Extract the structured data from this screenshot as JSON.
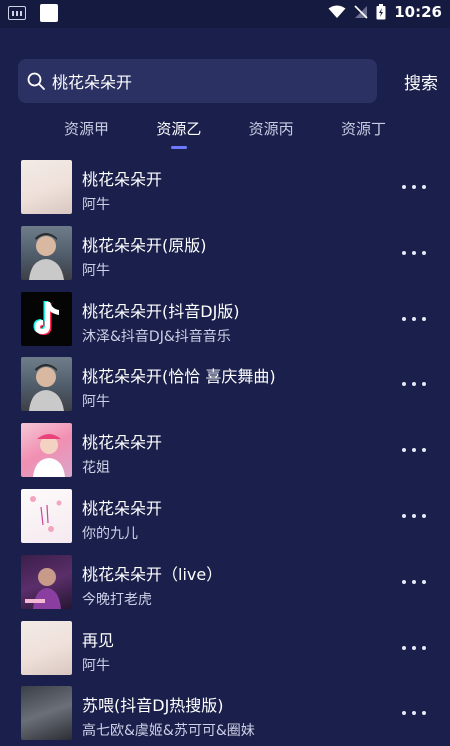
{
  "status_bar": {
    "time": "10:26"
  },
  "search": {
    "query": "桃花朵朵开",
    "button_label": "搜索"
  },
  "tabs": [
    {
      "label": "资源甲",
      "active": false
    },
    {
      "label": "资源乙",
      "active": true
    },
    {
      "label": "资源丙",
      "active": false
    },
    {
      "label": "资源丁",
      "active": false
    }
  ],
  "songs": [
    {
      "title": "桃花朵朵开",
      "artist": "阿牛",
      "cover": "photo-cover"
    },
    {
      "title": "桃花朵朵开(原版)",
      "artist": "阿牛",
      "cover": "man-cover"
    },
    {
      "title": "桃花朵朵开(抖音DJ版)",
      "artist": "沐泽&抖音DJ&抖音音乐",
      "cover": "tiktok-cover"
    },
    {
      "title": "桃花朵朵开(恰恰 喜庆舞曲)",
      "artist": "阿牛",
      "cover": "man-cover"
    },
    {
      "title": "桃花朵朵开",
      "artist": "花姐",
      "cover": "pink-cover"
    },
    {
      "title": "桃花朵朵开",
      "artist": "你的九儿",
      "cover": "white-cover"
    },
    {
      "title": "桃花朵朵开（live）",
      "artist": "今晚打老虎",
      "cover": "purple-cover"
    },
    {
      "title": "再见",
      "artist": "阿牛",
      "cover": "photo-cover"
    },
    {
      "title": "苏喂(抖音DJ热搜版)",
      "artist": "高七欧&虞姬&苏可可&圈妹",
      "cover": "dark-cover"
    }
  ],
  "colors": {
    "background": "#1a1f4b",
    "search_bg": "#2b3163",
    "accent": "#6f79ff"
  }
}
